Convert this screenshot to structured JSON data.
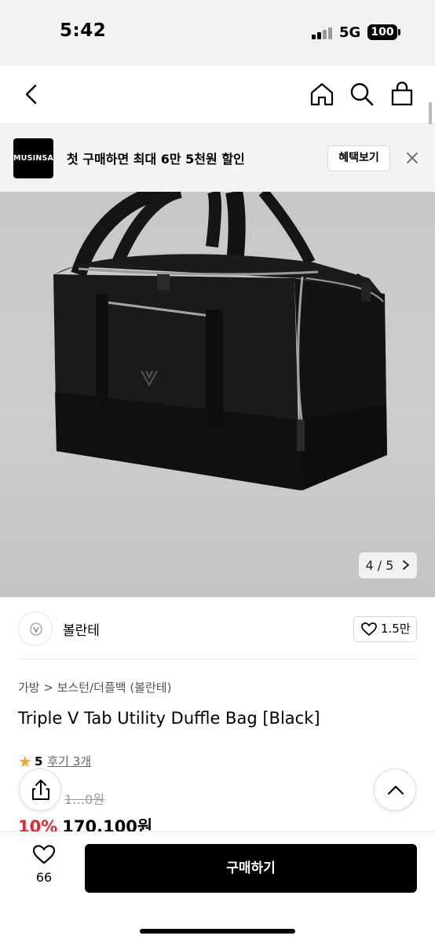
{
  "status": {
    "time": "5:42",
    "network": "5G",
    "battery": "100"
  },
  "promo": {
    "logo": "MUSINSA",
    "text": "첫 구매하면 최대 6만 5천원 할인",
    "button": "혜택보기"
  },
  "gallery": {
    "counter": "4 / 5"
  },
  "brand": {
    "name": "볼란테",
    "likes": "1.5만"
  },
  "product": {
    "breadcrumb": "가방 > 보스턴/더플백 (볼란테)",
    "title": "Triple V Tab Utility Duffle Bag [Black]",
    "rating": "5",
    "reviews": "후기 3개",
    "old_price_partial": "1…0원",
    "discount": "10%",
    "price": "170,100원"
  },
  "bottom": {
    "wish_count": "66",
    "buy_label": "구매하기"
  },
  "icons": [
    "back-icon",
    "home-icon",
    "search-icon",
    "bag-icon",
    "close-icon",
    "chevron-right-icon",
    "heart-icon",
    "share-icon",
    "chevron-up-icon",
    "star-icon"
  ],
  "colors": {
    "discount": "#e8262f",
    "star": "#f5a623",
    "buy_button": "#000000"
  }
}
